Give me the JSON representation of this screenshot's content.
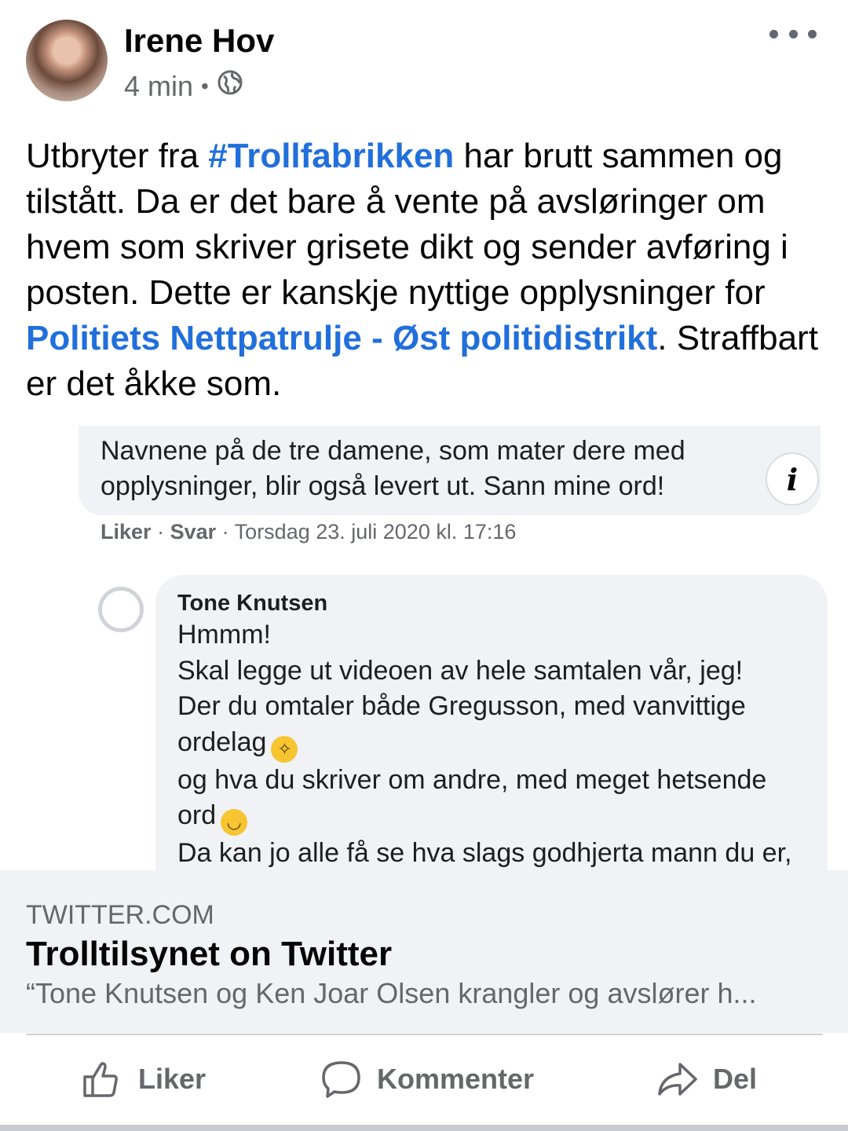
{
  "post": {
    "author": "Irene Hov",
    "time": "4 min",
    "separator": "•",
    "text_1": "Utbryter fra ",
    "hashtag": "#Trollfabrikken",
    "text_2": " har brutt sammen og tilstått. Da er det bare å vente på avsløringer om hvem som skriver grisete dikt og sender avføring i posten. Dette er kanskje nyttige opplysninger for ",
    "page_link": "Politiets Nettpatrulje - Øst politidistrikt",
    "text_3": ". Straffbart er det åkke som."
  },
  "screenshot": {
    "comment1_text": "Navnene på de tre damene, som mater dere med opplysninger, blir også levert ut. Sann mine ord!",
    "like": "Liker",
    "reply": "Svar",
    "sep": "·",
    "timestamp": "Torsdag 23. juli 2020 kl. 17:16",
    "info_glyph": "i",
    "comment2_author": "Tone Knutsen",
    "comment2_lines": [
      "Hmmm!",
      "Skal legge ut videoen av hele samtalen vår, jeg!",
      "Der du omtaler både Gregusson, med vanvittige",
      "ordelag",
      "og hva du skriver om andre, med meget hetsende",
      "ord",
      "Da kan jo alle få se hva slags godhjerta mann du er,"
    ]
  },
  "link_card": {
    "domain": "TWITTER.COM",
    "title": "Trolltilsynet on Twitter",
    "description": "“Tone Knutsen og Ken Joar Olsen krangler og avslører h..."
  },
  "actions": {
    "like": "Liker",
    "comment": "Kommenter",
    "share": "Del"
  },
  "colors": {
    "link": "#216fdb",
    "secondary_text": "#65676b",
    "bubble": "#f0f2f5"
  }
}
